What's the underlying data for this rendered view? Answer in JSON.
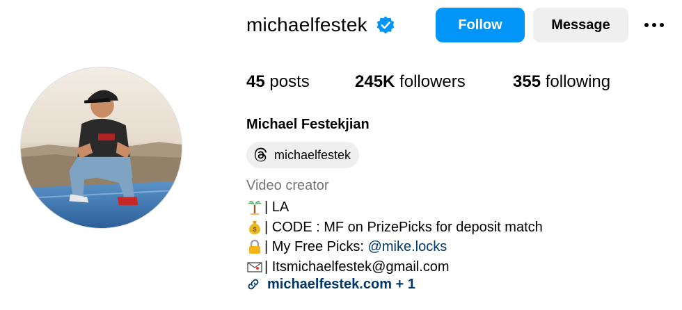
{
  "profile": {
    "username": "michaelfestek",
    "verified": true,
    "follow_label": "Follow",
    "message_label": "Message",
    "stats": {
      "posts_count": "45",
      "posts_label": "posts",
      "followers_count": "245K",
      "followers_label": "followers",
      "following_count": "355",
      "following_label": "following"
    },
    "full_name": "Michael Festekjian",
    "threads_handle": "michaelfestek",
    "category": "Video creator",
    "bio": [
      {
        "icon": "palm-tree-icon",
        "text": "| LA"
      },
      {
        "icon": "money-bag-icon",
        "text": "| CODE : MF on PrizePicks for deposit match"
      },
      {
        "icon": "lock-icon",
        "text": "| My Free Picks: ",
        "mention": "@mike.locks"
      },
      {
        "icon": "envelope-icon",
        "text": "| Itsmichaelfestek@gmail.com"
      }
    ],
    "link": "michaelfestek.com + 1"
  },
  "colors": {
    "follow_bg": "#0095f6",
    "message_bg": "#efefef",
    "link": "#00376b",
    "verified": "#0095f6",
    "category": "#737373"
  }
}
